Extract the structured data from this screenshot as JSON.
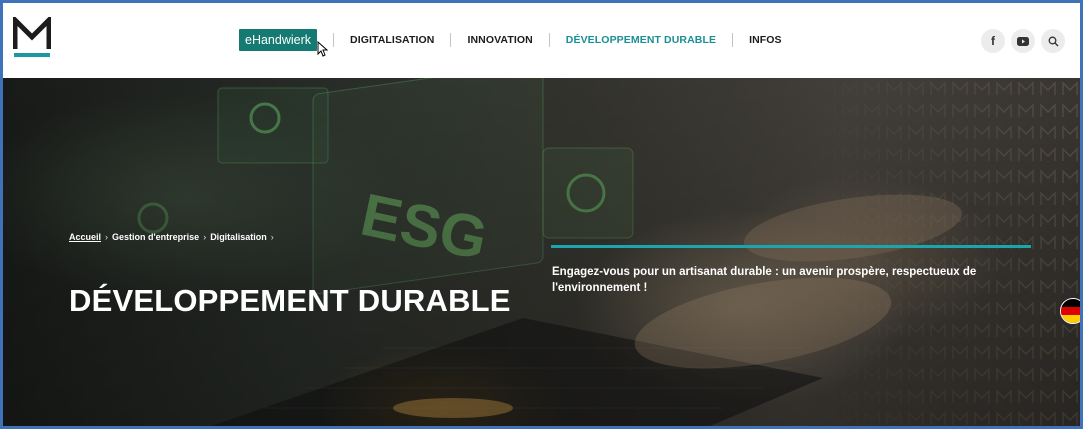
{
  "header": {
    "logo_text": "M",
    "nav": {
      "chip_label": "eHandwierk",
      "items": [
        {
          "label": "DIGITALISATION"
        },
        {
          "label": "INNOVATION"
        },
        {
          "label": "DÉVELOPPEMENT DURABLE"
        },
        {
          "label": "INFOS"
        }
      ],
      "active_index": 2
    },
    "social": [
      {
        "icon": "facebook-icon",
        "glyph": "f"
      },
      {
        "icon": "youtube-icon",
        "glyph": "▶"
      },
      {
        "icon": "search-icon",
        "glyph": "⚲"
      }
    ]
  },
  "hero": {
    "breadcrumb": {
      "home": "Accueil",
      "sep": "›",
      "items": [
        "Gestion d'entreprise",
        "Digitalisation"
      ]
    },
    "title": "DÉVELOPPEMENT DURABLE",
    "tagline": "Engagez-vous pour un artisanat durable : un avenir prospère, respectueux de l'environnement !",
    "overlay_text": "ESG",
    "language_flag": "german-flag-icon"
  },
  "colors": {
    "accent": "#1a9aa0",
    "chip": "#157a72",
    "active_nav": "#1a8f95",
    "frame_border": "#3f72b8"
  }
}
